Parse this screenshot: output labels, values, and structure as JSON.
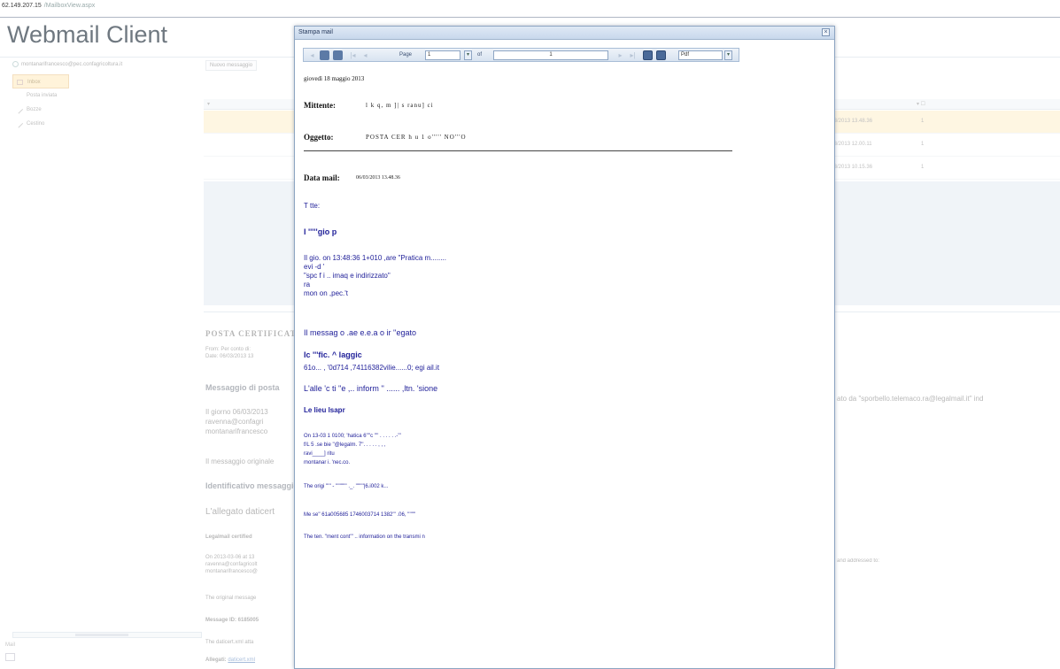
{
  "browser": {
    "address": "62.149.207.15",
    "address_tail": "/MailboxView.aspx"
  },
  "app": {
    "title": "Webmail Client",
    "user": "montanarifrancesco@pec.confagricoltura.it",
    "new_message": "Nuovo messaggio",
    "sidebar": [
      "Inbox",
      "Posta inviata",
      "Bozze",
      "Cestino"
    ],
    "rows": [
      {
        "date": "06/03/2013 13.48.36",
        "num": "1"
      },
      {
        "date": "06/03/2013 12.00.11",
        "num": "1"
      },
      {
        "date": "06/03/2013 10.15.36",
        "num": "1"
      }
    ],
    "preview": {
      "title": "POSTA CERTIFICATA",
      "from_line": "From: Per conto di:",
      "date_line": "Date: 06/03/2013 13",
      "heading": "Messaggio di posta",
      "body1": "Il giorno 06/03/2013",
      "body2": "ravenna@confagri",
      "body3": "montanarifrancesco",
      "orig": "Il messaggio originale",
      "ident": "Identificativo messaggio",
      "attached": "L'allegato daticert",
      "legalmail": "Legalmail certified",
      "on_line": "On 2013-03-06 at 13",
      "ravenna": "ravenna@confagricolt",
      "montanari": "montanarifrancesco@",
      "orig_en": "The original message",
      "message_id": "Message ID: 6185005",
      "datcert": "The daticert.xml atta",
      "allegati": "Allegati:",
      "allegati_link": "daticert.xml",
      "right1": "ato da \"sporbello.telemaco.ra@legalmail.it\" ind",
      "right2": "and addressed to:"
    },
    "mail_tab": "Mail"
  },
  "modal": {
    "title": "Stampa mail",
    "toolbar": {
      "page_label": "Page",
      "page_value": "1",
      "of_label": "of",
      "of_value": "1",
      "format_value": "Pdf"
    },
    "doc": {
      "date": "giovedì 18 maggio 2013",
      "mittente_label": "Mittente:",
      "mittente_value": "l    k q,        m      ]|    s           ranu]        ci",
      "oggetto_label": "Oggetto:",
      "oggetto_value": "POSTA CER       h     u     1       o'''''      NO'''O",
      "datamail_label": "Data mail:",
      "datamail_value": "06/03/2013 13.48.36",
      "l1": "T  tte:",
      "l2": "I     '''''gio    p",
      "l3a": "Il gio.                            on 13:48:36 1+010          ,are              \"Pratica m........",
      "l3b": "evi      -d  '",
      "l3c": "\"spc         f      i     ..          imaq e  indirizzato\"",
      "l3d": "ra",
      "l3e": "mon       on                  ,pec.'t",
      "l4": "Il messag      o     .ae e.e.a       o ir    ''egato",
      "l5": "Ic  '''fic.     ^      laggic",
      "l6": "61o...    ,               '0d714          ,74116382vilie......0;     egi    ail.it",
      "l7": "L'alle        'c     ti       ''e               ,.. inform             '' ......       ,ltn.      'sione",
      "l8": "Le                  lieu                  lsapr",
      "l9a": "On       13-03             1            0100;                     'hatica 6''''c   ''''  .  .  .   .  .         .-'''",
      "l9b": "f/L        5              .se                  bie                 ''@legalm.      7''.   .  .  .   .  ,    ,      ,",
      "l9c": "ravi____]               ritu",
      "l9d": "montanar       i.        'nec.co.",
      "l10": "The origi               '''''                       -                       '''''''''''         ._.  ''''''''|6.i002             k...",
      "l11": "Me       se''     61a005685 1746003714 1382'''          .06,          ''''''''",
      "l12": "The      ten.                 ''ment cont'''        .. information on the transmi       n"
    }
  }
}
